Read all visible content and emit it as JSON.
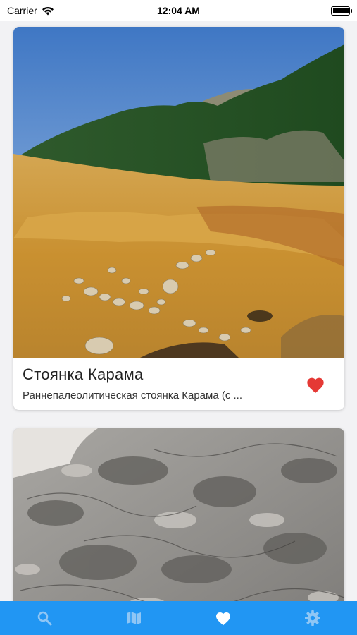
{
  "status_bar": {
    "carrier": "Carrier",
    "time": "12:04 AM",
    "battery_level": 1.0
  },
  "cards": [
    {
      "title": "Стоянка Карама",
      "description": "Раннепалеолитическая стоянка Карама (с ...",
      "favorite": true,
      "heart_color": "#e53935"
    },
    {
      "title": "",
      "description": "",
      "favorite": false
    }
  ],
  "tabbar": {
    "background": "#2196f3",
    "active_color": "#ffffff",
    "inactive_color": "#8fc6f5",
    "tabs": [
      {
        "icon": "search-icon",
        "active": false
      },
      {
        "icon": "map-icon",
        "active": false
      },
      {
        "icon": "heart-icon",
        "active": true
      },
      {
        "icon": "gear-icon",
        "active": false
      }
    ]
  }
}
